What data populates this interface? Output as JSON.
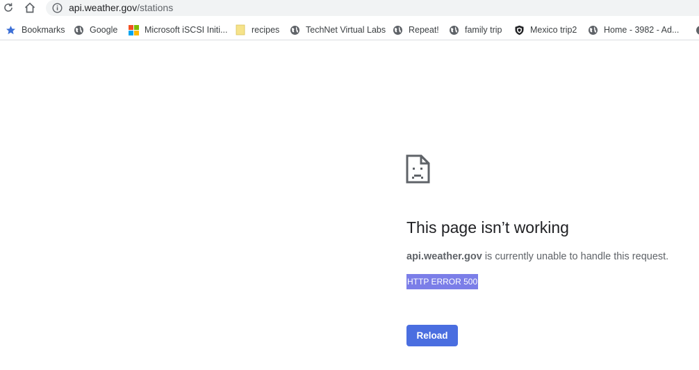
{
  "toolbar": {
    "reload_icon": "reload-icon",
    "home_icon": "home-icon",
    "info_icon": "info-icon",
    "url_host": "api.weather.gov",
    "url_path": "/stations"
  },
  "bookmarks": [
    {
      "label": "Bookmarks",
      "icon": "star-icon"
    },
    {
      "label": "Google",
      "icon": "globe-icon"
    },
    {
      "label": "Microsoft iSCSI Initi...",
      "icon": "microsoft-logo-icon"
    },
    {
      "label": "recipes",
      "icon": "folder-icon"
    },
    {
      "label": "TechNet Virtual Labs",
      "icon": "globe-icon"
    },
    {
      "label": "Repeat!",
      "icon": "globe-icon"
    },
    {
      "label": "family trip",
      "icon": "globe-icon"
    },
    {
      "label": "Mexico trip2",
      "icon": "shield-icon"
    },
    {
      "label": "Home - 3982 - Ad...",
      "icon": "globe-icon"
    }
  ],
  "error": {
    "icon": "sad-page-icon",
    "title": "This page isn’t working",
    "host": "api.weather.gov",
    "message": " is currently unable to handle this request.",
    "code": "HTTP ERROR 500",
    "reload_label": "Reload"
  },
  "colors": {
    "reload_button": "#4a6ee0",
    "error_code_highlight": "#7b7ee8",
    "star": "#3c6fd6",
    "folder": "#f6e38a"
  }
}
